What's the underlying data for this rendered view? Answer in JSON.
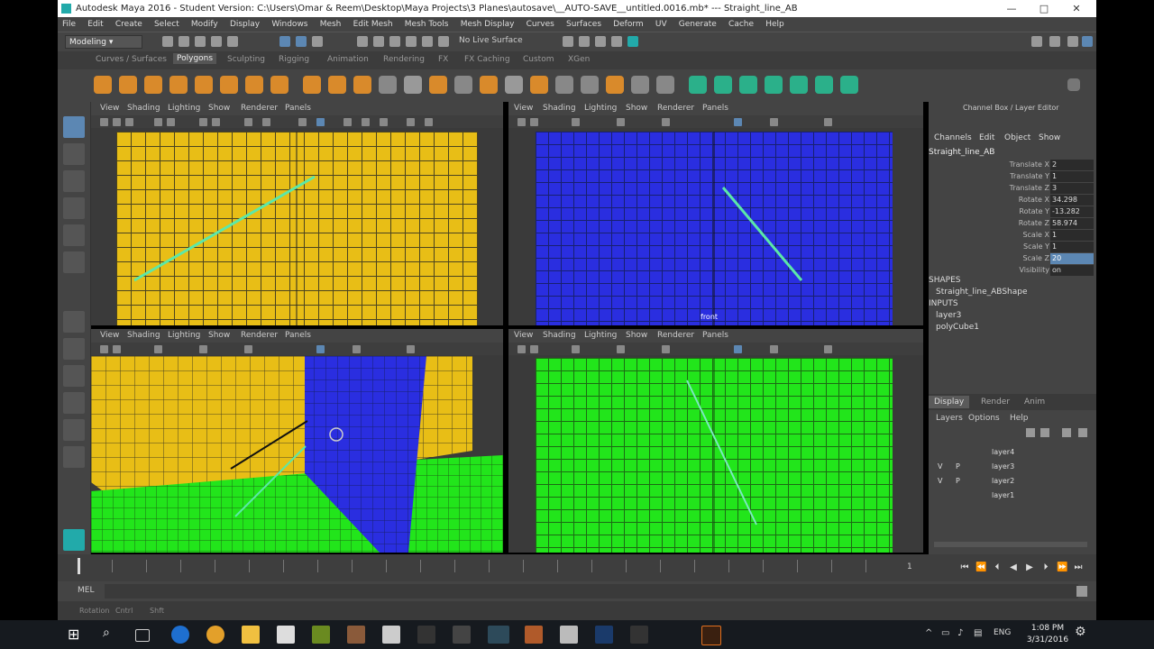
{
  "window": {
    "title": "Autodesk Maya 2016 - Student Version: C:\\Users\\Omar & Reem\\Desktop\\Maya Projects\\3 Planes\\autosave\\__AUTO-SAVE__untitled.0016.mb*   ---   Straight_line_AB",
    "minimize": "—",
    "maximize": "□",
    "close": "✕"
  },
  "menu": [
    "File",
    "Edit",
    "Create",
    "Select",
    "Modify",
    "Display",
    "Windows",
    "Mesh",
    "Edit Mesh",
    "Mesh Tools",
    "Mesh Display",
    "Curves",
    "Surfaces",
    "Deform",
    "UV",
    "Generate",
    "Cache",
    "Help"
  ],
  "status_line": {
    "mode": "Modeling",
    "live_surface": "No Live Surface"
  },
  "shelf_tabs": [
    "Curves / Surfaces",
    "Polygons",
    "Sculpting",
    "Rigging",
    "Animation",
    "Rendering",
    "FX",
    "FX Caching",
    "Custom",
    "XGen"
  ],
  "shelf_active": "Polygons",
  "viewport_menu": [
    "View",
    "Shading",
    "Lighting",
    "Show",
    "Renderer",
    "Panels"
  ],
  "viewports": {
    "top_right_label": "front"
  },
  "channel_box": {
    "header": "Channel Box / Layer Editor",
    "menu": [
      "Channels",
      "Edit",
      "Object",
      "Show"
    ],
    "object": "Straight_line_AB",
    "attributes": [
      {
        "label": "Translate X",
        "value": "2"
      },
      {
        "label": "Translate Y",
        "value": "1"
      },
      {
        "label": "Translate Z",
        "value": "3"
      },
      {
        "label": "Rotate X",
        "value": "34.298"
      },
      {
        "label": "Rotate Y",
        "value": "-13.282"
      },
      {
        "label": "Rotate Z",
        "value": "58.974"
      },
      {
        "label": "Scale X",
        "value": "1"
      },
      {
        "label": "Scale Y",
        "value": "1"
      },
      {
        "label": "Scale Z",
        "value": "20"
      },
      {
        "label": "Visibility",
        "value": "on"
      }
    ],
    "shapes_header": "SHAPES",
    "shape": "Straight_line_ABShape",
    "inputs_header": "INPUTS",
    "inputs": [
      "layer3",
      "polyCube1"
    ]
  },
  "layer_editor": {
    "tabs": [
      "Display",
      "Render",
      "Anim"
    ],
    "menu": [
      "Layers",
      "Options",
      "Help"
    ],
    "layers": [
      {
        "v": "",
        "p": "",
        "name": "layer4"
      },
      {
        "v": "V",
        "p": "P",
        "name": "layer3"
      },
      {
        "v": "V",
        "p": "P",
        "name": "layer2"
      },
      {
        "v": "",
        "p": "",
        "name": "layer1"
      }
    ]
  },
  "timeline": {
    "current_frame": "1"
  },
  "command_line": {
    "label": "MEL"
  },
  "help_line": [
    "Rotation",
    "Cntrl",
    "Shft"
  ],
  "taskbar": {
    "language": "ENG",
    "time": "1:08 PM",
    "date": "3/31/2016"
  }
}
